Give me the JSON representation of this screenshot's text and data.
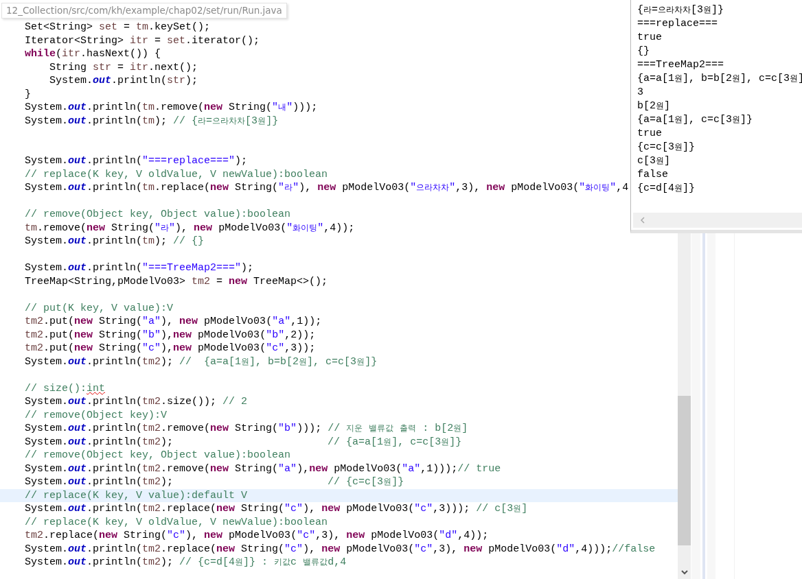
{
  "path_tooltip": "12_Collection/src/com/kh/example/chap02/set/run/Run.java",
  "editor": {
    "lines": [
      {
        "current": false,
        "tokens": [
          {
            "kind": "text",
            "text": "Set<String> "
          },
          {
            "kind": "local",
            "text": "set"
          },
          {
            "kind": "text",
            "text": " = "
          },
          {
            "kind": "local",
            "text": "tm"
          },
          {
            "kind": "text",
            "text": ".keySet();"
          }
        ]
      },
      {
        "current": false,
        "tokens": [
          {
            "kind": "text",
            "text": "Iterator<String> "
          },
          {
            "kind": "local",
            "text": "itr"
          },
          {
            "kind": "text",
            "text": " = "
          },
          {
            "kind": "local",
            "text": "set"
          },
          {
            "kind": "text",
            "text": ".iterator();"
          }
        ]
      },
      {
        "current": false,
        "tokens": [
          {
            "kind": "keyword",
            "text": "while"
          },
          {
            "kind": "text",
            "text": "("
          },
          {
            "kind": "local",
            "text": "itr"
          },
          {
            "kind": "text",
            "text": ".hasNext()) {"
          }
        ]
      },
      {
        "current": false,
        "tokens": [
          {
            "kind": "text",
            "text": "    String "
          },
          {
            "kind": "local",
            "text": "str"
          },
          {
            "kind": "text",
            "text": " = "
          },
          {
            "kind": "local",
            "text": "itr"
          },
          {
            "kind": "text",
            "text": ".next();"
          }
        ]
      },
      {
        "current": false,
        "tokens": [
          {
            "kind": "text",
            "text": "    System."
          },
          {
            "kind": "field",
            "text": "out"
          },
          {
            "kind": "text",
            "text": ".println("
          },
          {
            "kind": "local",
            "text": "str"
          },
          {
            "kind": "text",
            "text": ");"
          }
        ]
      },
      {
        "current": false,
        "tokens": [
          {
            "kind": "text",
            "text": "}"
          }
        ]
      },
      {
        "current": false,
        "tokens": [
          {
            "kind": "text",
            "text": "System."
          },
          {
            "kind": "field",
            "text": "out"
          },
          {
            "kind": "text",
            "text": ".println("
          },
          {
            "kind": "local",
            "text": "tm"
          },
          {
            "kind": "text",
            "text": ".remove("
          },
          {
            "kind": "keyword",
            "text": "new"
          },
          {
            "kind": "text",
            "text": " String("
          },
          {
            "kind": "string",
            "text": "\"내\""
          },
          {
            "kind": "text",
            "text": ")));"
          }
        ]
      },
      {
        "current": false,
        "tokens": [
          {
            "kind": "text",
            "text": "System."
          },
          {
            "kind": "field",
            "text": "out"
          },
          {
            "kind": "text",
            "text": ".println("
          },
          {
            "kind": "local",
            "text": "tm"
          },
          {
            "kind": "text",
            "text": "); "
          },
          {
            "kind": "comment",
            "text": "// {라=으라차차[3원]}"
          }
        ]
      },
      {
        "current": false
      },
      {
        "current": false
      },
      {
        "current": false,
        "tokens": [
          {
            "kind": "text",
            "text": "System."
          },
          {
            "kind": "field",
            "text": "out"
          },
          {
            "kind": "text",
            "text": ".println("
          },
          {
            "kind": "string",
            "text": "\"===replace===\""
          },
          {
            "kind": "text",
            "text": ");"
          }
        ]
      },
      {
        "current": false,
        "tokens": [
          {
            "kind": "comment",
            "text": "// replace(K key, V oldValue, V newValue):boolean"
          }
        ]
      },
      {
        "current": false,
        "tokens": [
          {
            "kind": "text",
            "text": "System."
          },
          {
            "kind": "field",
            "text": "out"
          },
          {
            "kind": "text",
            "text": ".println("
          },
          {
            "kind": "local",
            "text": "tm"
          },
          {
            "kind": "text",
            "text": ".replace("
          },
          {
            "kind": "keyword",
            "text": "new"
          },
          {
            "kind": "text",
            "text": " String("
          },
          {
            "kind": "string",
            "text": "\"라\""
          },
          {
            "kind": "text",
            "text": "), "
          },
          {
            "kind": "keyword",
            "text": "new"
          },
          {
            "kind": "text",
            "text": " pModelVo03("
          },
          {
            "kind": "string",
            "text": "\"으라차차\""
          },
          {
            "kind": "text",
            "text": ",3), "
          },
          {
            "kind": "keyword",
            "text": "new"
          },
          {
            "kind": "text",
            "text": " pModelVo03("
          },
          {
            "kind": "string",
            "text": "\"화이팅\""
          },
          {
            "kind": "text",
            "text": ",4"
          }
        ]
      },
      {
        "current": false
      },
      {
        "current": false,
        "tokens": [
          {
            "kind": "comment",
            "text": "// remove(Object key, Object value):boolean"
          }
        ]
      },
      {
        "current": false,
        "tokens": [
          {
            "kind": "local",
            "text": "tm"
          },
          {
            "kind": "text",
            "text": ".remove("
          },
          {
            "kind": "keyword",
            "text": "new"
          },
          {
            "kind": "text",
            "text": " String("
          },
          {
            "kind": "string",
            "text": "\"라\""
          },
          {
            "kind": "text",
            "text": "), "
          },
          {
            "kind": "keyword",
            "text": "new"
          },
          {
            "kind": "text",
            "text": " pModelVo03("
          },
          {
            "kind": "string",
            "text": "\"화이팅\""
          },
          {
            "kind": "text",
            "text": ",4));"
          }
        ]
      },
      {
        "current": false,
        "tokens": [
          {
            "kind": "text",
            "text": "System."
          },
          {
            "kind": "field",
            "text": "out"
          },
          {
            "kind": "text",
            "text": ".println("
          },
          {
            "kind": "local",
            "text": "tm"
          },
          {
            "kind": "text",
            "text": "); "
          },
          {
            "kind": "comment",
            "text": "// {}"
          }
        ]
      },
      {
        "current": false
      },
      {
        "current": false,
        "tokens": [
          {
            "kind": "text",
            "text": "System."
          },
          {
            "kind": "field",
            "text": "out"
          },
          {
            "kind": "text",
            "text": ".println("
          },
          {
            "kind": "string",
            "text": "\"===TreeMap2===\""
          },
          {
            "kind": "text",
            "text": ");"
          }
        ]
      },
      {
        "current": false,
        "tokens": [
          {
            "kind": "text",
            "text": "TreeMap<String,pModelVo03> "
          },
          {
            "kind": "local",
            "text": "tm2"
          },
          {
            "kind": "text",
            "text": " = "
          },
          {
            "kind": "keyword",
            "text": "new"
          },
          {
            "kind": "text",
            "text": " TreeMap<>();"
          }
        ]
      },
      {
        "current": false
      },
      {
        "current": false,
        "tokens": [
          {
            "kind": "comment",
            "text": "// put(K key, V value):V"
          }
        ]
      },
      {
        "current": false,
        "tokens": [
          {
            "kind": "local",
            "text": "tm2"
          },
          {
            "kind": "text",
            "text": ".put("
          },
          {
            "kind": "keyword",
            "text": "new"
          },
          {
            "kind": "text",
            "text": " String("
          },
          {
            "kind": "string",
            "text": "\"a\""
          },
          {
            "kind": "text",
            "text": "), "
          },
          {
            "kind": "keyword",
            "text": "new"
          },
          {
            "kind": "text",
            "text": " pModelVo03("
          },
          {
            "kind": "string",
            "text": "\"a\""
          },
          {
            "kind": "text",
            "text": ",1));"
          }
        ]
      },
      {
        "current": false,
        "tokens": [
          {
            "kind": "local",
            "text": "tm2"
          },
          {
            "kind": "text",
            "text": ".put("
          },
          {
            "kind": "keyword",
            "text": "new"
          },
          {
            "kind": "text",
            "text": " String("
          },
          {
            "kind": "string",
            "text": "\"b\""
          },
          {
            "kind": "text",
            "text": "),"
          },
          {
            "kind": "keyword",
            "text": "new"
          },
          {
            "kind": "text",
            "text": " pModelVo03("
          },
          {
            "kind": "string",
            "text": "\"b\""
          },
          {
            "kind": "text",
            "text": ",2));"
          }
        ]
      },
      {
        "current": false,
        "tokens": [
          {
            "kind": "local",
            "text": "tm2"
          },
          {
            "kind": "text",
            "text": ".put("
          },
          {
            "kind": "keyword",
            "text": "new"
          },
          {
            "kind": "text",
            "text": " String("
          },
          {
            "kind": "string",
            "text": "\"c\""
          },
          {
            "kind": "text",
            "text": "),"
          },
          {
            "kind": "keyword",
            "text": "new"
          },
          {
            "kind": "text",
            "text": " pModelVo03("
          },
          {
            "kind": "string",
            "text": "\"c\""
          },
          {
            "kind": "text",
            "text": ",3));"
          }
        ]
      },
      {
        "current": false,
        "tokens": [
          {
            "kind": "text",
            "text": "System."
          },
          {
            "kind": "field",
            "text": "out"
          },
          {
            "kind": "text",
            "text": ".println("
          },
          {
            "kind": "local",
            "text": "tm2"
          },
          {
            "kind": "text",
            "text": "); "
          },
          {
            "kind": "comment",
            "text": "//  {a=a[1원], b=b[2원], c=c[3원]}"
          }
        ]
      },
      {
        "current": false
      },
      {
        "current": false,
        "tokens": [
          {
            "kind": "comment",
            "text": "// size():"
          },
          {
            "kind": "comment",
            "text": "int",
            "misspelled": true
          }
        ]
      },
      {
        "current": false,
        "tokens": [
          {
            "kind": "text",
            "text": "System."
          },
          {
            "kind": "field",
            "text": "out"
          },
          {
            "kind": "text",
            "text": ".println("
          },
          {
            "kind": "local",
            "text": "tm2"
          },
          {
            "kind": "text",
            "text": ".size()); "
          },
          {
            "kind": "comment",
            "text": "// 2"
          }
        ]
      },
      {
        "current": false,
        "tokens": [
          {
            "kind": "comment",
            "text": "// remove(Object key):V"
          }
        ]
      },
      {
        "current": false,
        "tokens": [
          {
            "kind": "text",
            "text": "System."
          },
          {
            "kind": "field",
            "text": "out"
          },
          {
            "kind": "text",
            "text": ".println("
          },
          {
            "kind": "local",
            "text": "tm2"
          },
          {
            "kind": "text",
            "text": ".remove("
          },
          {
            "kind": "keyword",
            "text": "new"
          },
          {
            "kind": "text",
            "text": " String("
          },
          {
            "kind": "string",
            "text": "\"b\""
          },
          {
            "kind": "text",
            "text": "))); "
          },
          {
            "kind": "comment",
            "text": "// 지운 밸류값 출력 : b[2원]"
          }
        ]
      },
      {
        "current": false,
        "tokens": [
          {
            "kind": "text",
            "text": "System."
          },
          {
            "kind": "field",
            "text": "out"
          },
          {
            "kind": "text",
            "text": ".println("
          },
          {
            "kind": "local",
            "text": "tm2"
          },
          {
            "kind": "text",
            "text": ");                         "
          },
          {
            "kind": "comment",
            "text": "// {a=a[1원], c=c[3원]}"
          }
        ]
      },
      {
        "current": false,
        "tokens": [
          {
            "kind": "comment",
            "text": "// remove(Object key, Object value):boolean"
          }
        ]
      },
      {
        "current": false,
        "tokens": [
          {
            "kind": "text",
            "text": "System."
          },
          {
            "kind": "field",
            "text": "out"
          },
          {
            "kind": "text",
            "text": ".println("
          },
          {
            "kind": "local",
            "text": "tm2"
          },
          {
            "kind": "text",
            "text": ".remove("
          },
          {
            "kind": "keyword",
            "text": "new"
          },
          {
            "kind": "text",
            "text": " String("
          },
          {
            "kind": "string",
            "text": "\"a\""
          },
          {
            "kind": "text",
            "text": "),"
          },
          {
            "kind": "keyword",
            "text": "new"
          },
          {
            "kind": "text",
            "text": " pModelVo03("
          },
          {
            "kind": "string",
            "text": "\"a\""
          },
          {
            "kind": "text",
            "text": ",1)));"
          },
          {
            "kind": "comment",
            "text": "// true"
          }
        ]
      },
      {
        "current": false,
        "tokens": [
          {
            "kind": "text",
            "text": "System."
          },
          {
            "kind": "field",
            "text": "out"
          },
          {
            "kind": "text",
            "text": ".println("
          },
          {
            "kind": "local",
            "text": "tm2"
          },
          {
            "kind": "text",
            "text": ");                         "
          },
          {
            "kind": "comment",
            "text": "// {c=c[3원]}"
          }
        ]
      },
      {
        "current": true,
        "tokens": [
          {
            "kind": "comment",
            "text": "// replace(K key, V value):default V"
          }
        ]
      },
      {
        "current": false,
        "tokens": [
          {
            "kind": "text",
            "text": "System."
          },
          {
            "kind": "field",
            "text": "out"
          },
          {
            "kind": "text",
            "text": ".println("
          },
          {
            "kind": "local",
            "text": "tm2"
          },
          {
            "kind": "text",
            "text": ".replace("
          },
          {
            "kind": "keyword",
            "text": "new"
          },
          {
            "kind": "text",
            "text": " String("
          },
          {
            "kind": "string",
            "text": "\"c\""
          },
          {
            "kind": "text",
            "text": "), "
          },
          {
            "kind": "keyword",
            "text": "new"
          },
          {
            "kind": "text",
            "text": " pModelVo03("
          },
          {
            "kind": "string",
            "text": "\"c\""
          },
          {
            "kind": "text",
            "text": ",3))); "
          },
          {
            "kind": "comment",
            "text": "// c[3원]"
          }
        ]
      },
      {
        "current": false,
        "tokens": [
          {
            "kind": "comment",
            "text": "// replace(K key, V oldValue, V newValue):boolean"
          }
        ]
      },
      {
        "current": false,
        "tokens": [
          {
            "kind": "local",
            "text": "tm2"
          },
          {
            "kind": "text",
            "text": ".replace("
          },
          {
            "kind": "keyword",
            "text": "new"
          },
          {
            "kind": "text",
            "text": " String("
          },
          {
            "kind": "string",
            "text": "\"c\""
          },
          {
            "kind": "text",
            "text": "), "
          },
          {
            "kind": "keyword",
            "text": "new"
          },
          {
            "kind": "text",
            "text": " pModelVo03("
          },
          {
            "kind": "string",
            "text": "\"c\""
          },
          {
            "kind": "text",
            "text": ",3), "
          },
          {
            "kind": "keyword",
            "text": "new"
          },
          {
            "kind": "text",
            "text": " pModelVo03("
          },
          {
            "kind": "string",
            "text": "\"d\""
          },
          {
            "kind": "text",
            "text": ",4));"
          }
        ]
      },
      {
        "current": false,
        "tokens": [
          {
            "kind": "text",
            "text": "System."
          },
          {
            "kind": "field",
            "text": "out"
          },
          {
            "kind": "text",
            "text": ".println("
          },
          {
            "kind": "local",
            "text": "tm2"
          },
          {
            "kind": "text",
            "text": ".replace("
          },
          {
            "kind": "keyword",
            "text": "new"
          },
          {
            "kind": "text",
            "text": " String("
          },
          {
            "kind": "string",
            "text": "\"c\""
          },
          {
            "kind": "text",
            "text": "), "
          },
          {
            "kind": "keyword",
            "text": "new"
          },
          {
            "kind": "text",
            "text": " pModelVo03("
          },
          {
            "kind": "string",
            "text": "\"c\""
          },
          {
            "kind": "text",
            "text": ",3), "
          },
          {
            "kind": "keyword",
            "text": "new"
          },
          {
            "kind": "text",
            "text": " pModelVo03("
          },
          {
            "kind": "string",
            "text": "\"d\""
          },
          {
            "kind": "text",
            "text": ",4)));"
          },
          {
            "kind": "comment",
            "text": "//false"
          }
        ]
      },
      {
        "current": false,
        "tokens": [
          {
            "kind": "text",
            "text": "System."
          },
          {
            "kind": "field",
            "text": "out"
          },
          {
            "kind": "text",
            "text": ".println("
          },
          {
            "kind": "local",
            "text": "tm2"
          },
          {
            "kind": "text",
            "text": "); "
          },
          {
            "kind": "comment",
            "text": "// {c=d[4원]} : 키값c 밸류값d,4"
          }
        ]
      }
    ]
  },
  "console": {
    "lines": [
      "{라=으라차차[3원]}",
      "===replace===",
      "true",
      "{}",
      "===TreeMap2===",
      "{a=a[1원], b=b[2원], c=c[3원]",
      "3",
      "b[2원]",
      "{a=a[1원], c=c[3원]}",
      "true",
      "{c=c[3원]}",
      "c[3원]",
      "false",
      "{c=d[4원]}"
    ]
  }
}
